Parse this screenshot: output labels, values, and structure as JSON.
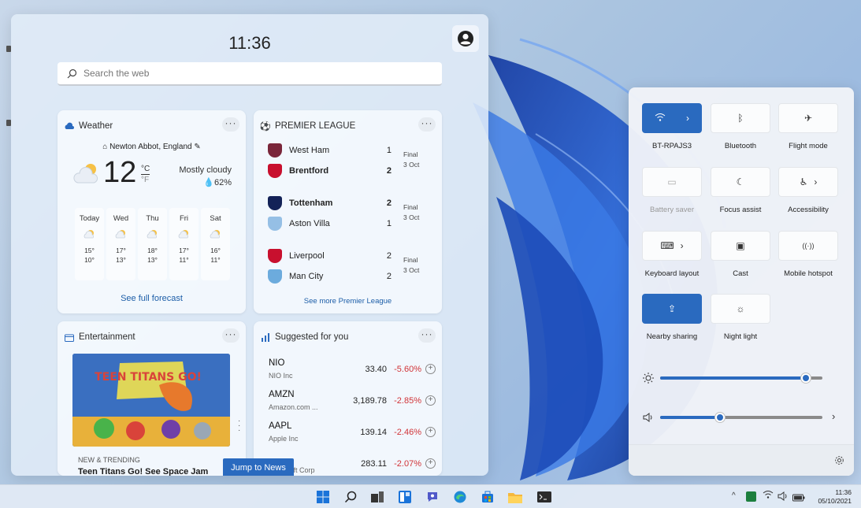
{
  "widgets": {
    "clock": "11:36",
    "search_placeholder": "Search the web",
    "weather": {
      "title": "Weather",
      "location": "Newton Abbot, England",
      "temp": "12",
      "unit_c": "°C",
      "unit_f": "°F",
      "condition": "Mostly cloudy",
      "humidity": "62%",
      "days": [
        {
          "name": "Today",
          "high": "15°",
          "low": "10°"
        },
        {
          "name": "Wed",
          "high": "17°",
          "low": "13°"
        },
        {
          "name": "Thu",
          "high": "18°",
          "low": "13°"
        },
        {
          "name": "Fri",
          "high": "17°",
          "low": "11°"
        },
        {
          "name": "Sat",
          "high": "16°",
          "low": "11°"
        }
      ],
      "link": "See full forecast"
    },
    "premier_league": {
      "title": "PREMIER LEAGUE",
      "matches": [
        {
          "home": "West Ham",
          "home_score": "1",
          "away": "Brentford",
          "away_score": "2",
          "status": "Final",
          "date": "3 Oct"
        },
        {
          "home": "Tottenham",
          "home_score": "2",
          "away": "Aston Villa",
          "away_score": "1",
          "status": "Final",
          "date": "3 Oct"
        },
        {
          "home": "Liverpool",
          "home_score": "2",
          "away": "Man City",
          "away_score": "2",
          "status": "Final",
          "date": "3 Oct"
        }
      ],
      "link": "See more Premier League"
    },
    "entertainment": {
      "title": "Entertainment",
      "tag": "NEW & TRENDING",
      "headline": "Teen Titans Go! See Space Jam",
      "image_text": "TEEN TITANS GO!"
    },
    "stocks": {
      "title": "Suggested for you",
      "items": [
        {
          "ticker": "NIO",
          "company": "NIO Inc",
          "price": "33.40",
          "change": "-5.60%"
        },
        {
          "ticker": "AMZN",
          "company": "Amazon.com ...",
          "price": "3,189.78",
          "change": "-2.85%"
        },
        {
          "ticker": "AAPL",
          "company": "Apple Inc",
          "price": "139.14",
          "change": "-2.46%"
        },
        {
          "ticker": "",
          "company": "Microsoft Corp",
          "price": "283.11",
          "change": "-2.07%"
        }
      ]
    },
    "jump_button": "Jump to News"
  },
  "quick_settings": {
    "tiles": [
      {
        "label": "BT-RPAJS3",
        "icon": "wifi-icon",
        "on": true
      },
      {
        "label": "Bluetooth",
        "icon": "bluetooth-icon",
        "on": false
      },
      {
        "label": "Flight mode",
        "icon": "airplane-icon",
        "on": false
      },
      {
        "label": "Battery saver",
        "icon": "battery-icon",
        "on": false,
        "disabled": true
      },
      {
        "label": "Focus assist",
        "icon": "moon-icon",
        "on": false
      },
      {
        "label": "Accessibility",
        "icon": "accessibility-icon",
        "on": false
      },
      {
        "label": "Keyboard layout",
        "icon": "keyboard-icon",
        "on": false
      },
      {
        "label": "Cast",
        "icon": "cast-icon",
        "on": false
      },
      {
        "label": "Mobile hotspot",
        "icon": "hotspot-icon",
        "on": false
      },
      {
        "label": "Nearby sharing",
        "icon": "share-icon",
        "on": true
      },
      {
        "label": "Night light",
        "icon": "sun-icon",
        "on": false
      }
    ],
    "brightness": 0.9,
    "volume": 0.37,
    "accent": "#2a6abf"
  },
  "taskbar": {
    "time": "11:36",
    "date": "05/10/2021",
    "icons": [
      "start-icon",
      "search-icon",
      "widgets-icon",
      "snap-icon",
      "chat-icon",
      "edge-icon",
      "store-icon",
      "explorer-icon",
      "terminal-icon"
    ]
  }
}
